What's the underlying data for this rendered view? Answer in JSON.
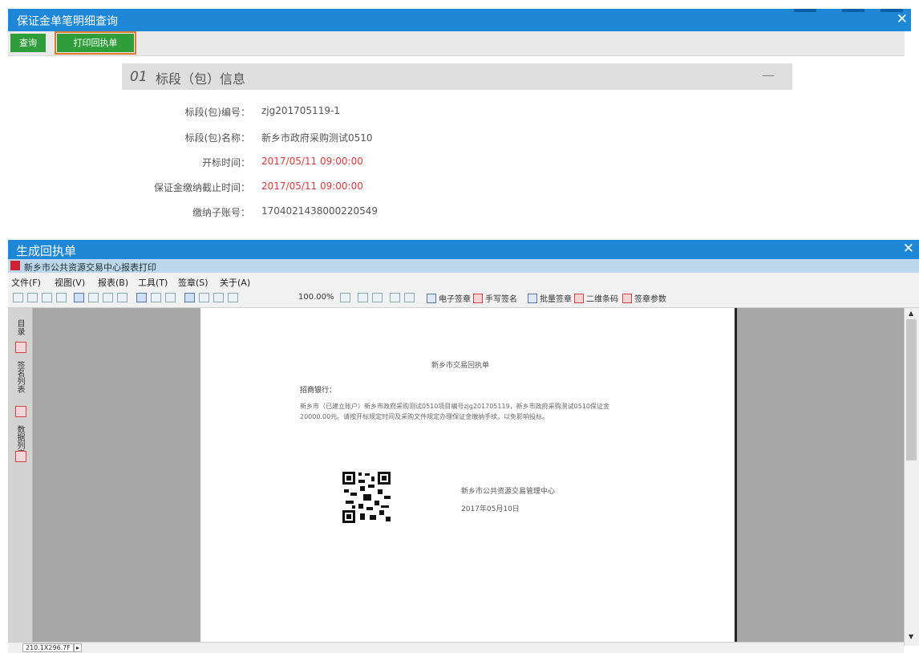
{
  "top_window": {
    "title": "保证金单笔明细查询",
    "close": "✕",
    "toolbar": {
      "query_label": "查询",
      "print_receipt_label": "打印回执单"
    },
    "section": {
      "number": "01",
      "title": "标段（包）信息",
      "collapse": "—"
    },
    "fields": [
      {
        "label": "标段(包)编号：",
        "value": "zjg201705119-1"
      },
      {
        "label": "标段(包)名称：",
        "value": "新乡市政府采购测试0510"
      },
      {
        "label": "开标时间：",
        "value": "2017/05/11 09:00:00"
      },
      {
        "label": "保证金缴纳截止时间：",
        "value": "2017/05/11 09:00:00"
      },
      {
        "label": "缴纳子账号：",
        "value": "17040214380002205​49"
      }
    ]
  },
  "bottom_window": {
    "title": "生成回执单",
    "close": "✕",
    "app_title": "新乡市公共资源交易中心报表打印",
    "menu": [
      "文件(F)",
      "视图(V)",
      "报表(B)",
      "工具(T)",
      "签章(S)",
      "关于(A)"
    ],
    "zoom": "100.00%",
    "toolbar_labels": [
      "电子签章",
      "手写签名",
      "批量签章",
      "二维条码",
      "签章参数"
    ],
    "side_tabs": [
      "目录",
      "签名列表",
      "数据列表"
    ],
    "document": {
      "title": "新乡市交易回执单",
      "salutation": "招商银行：",
      "body": "新乡市（已建立账户）新乡市政府采购测试0510项目编号zjg201705119，新乡市政府采购测试0510保证金20000.00元。请按开标规定时间及采购文件规定办理保证金缴纳手续，以免影响投标。",
      "org": "新乡市公共资源交易管理中心",
      "date": "2017年05月10日"
    },
    "status_dims": "210.1X296.7F",
    "status_arrow": "▸"
  }
}
